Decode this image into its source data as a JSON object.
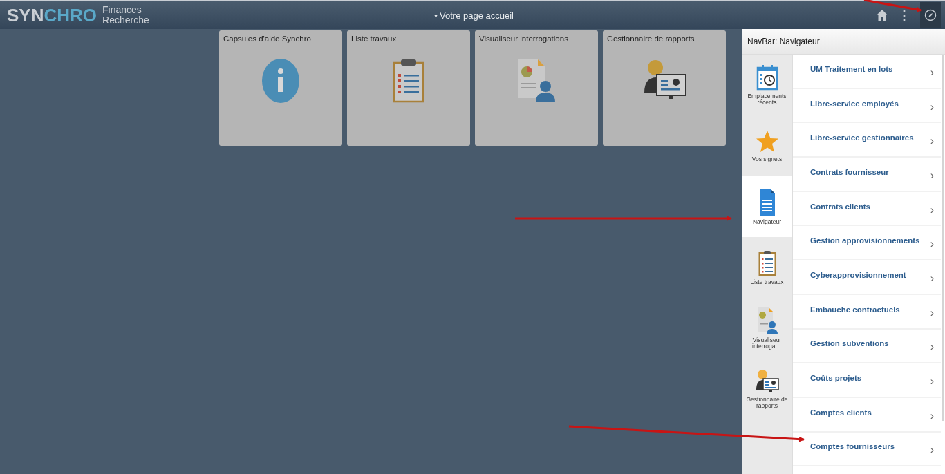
{
  "header": {
    "logo": {
      "lead": "SYN",
      "accent": "CHRO"
    },
    "subtitle": [
      "Finances",
      "Recherche"
    ],
    "page_caret": "▾",
    "page_title": "Votre page accueil",
    "kebab": "⋮"
  },
  "tiles": [
    {
      "title": "Capsules d'aide Synchro",
      "kind": "info"
    },
    {
      "title": "Liste travaux",
      "kind": "worklist"
    },
    {
      "title": "Visualiseur interrogations",
      "kind": "query"
    },
    {
      "title": "Gestionnaire de rapports",
      "kind": "reports"
    }
  ],
  "navbar": {
    "title": "NavBar: Navigateur",
    "tabs": [
      {
        "label": "Emplacements récents",
        "kind": "recent",
        "selected": false
      },
      {
        "label": "Vos signets",
        "kind": "bookmarks",
        "selected": false
      },
      {
        "label": "Navigateur",
        "kind": "navigator",
        "selected": true
      },
      {
        "label": "Liste travaux",
        "kind": "worklist",
        "selected": false
      },
      {
        "label": "Visualiseur interrogat...",
        "kind": "query",
        "selected": false
      },
      {
        "label": "Gestionnaire de rapports",
        "kind": "reports",
        "selected": false
      }
    ],
    "items": [
      {
        "label": "UM Traitement en lots",
        "chevron": "›"
      },
      {
        "label": "Libre-service employés",
        "chevron": "›"
      },
      {
        "label": "Libre-service gestionnaires",
        "chevron": "›"
      },
      {
        "label": "Contrats fournisseur",
        "chevron": "›"
      },
      {
        "label": "Contrats clients",
        "chevron": "›"
      },
      {
        "label": "Gestion approvisionnements",
        "chevron": "›"
      },
      {
        "label": "Cyberapprovisionnement",
        "chevron": "›"
      },
      {
        "label": "Embauche contractuels",
        "chevron": "›"
      },
      {
        "label": "Gestion subventions",
        "chevron": "›"
      },
      {
        "label": "Coûts projets",
        "chevron": "›"
      },
      {
        "label": "Comptes clients",
        "chevron": "›"
      },
      {
        "label": "Comptes fournisseurs",
        "chevron": "›"
      }
    ]
  }
}
